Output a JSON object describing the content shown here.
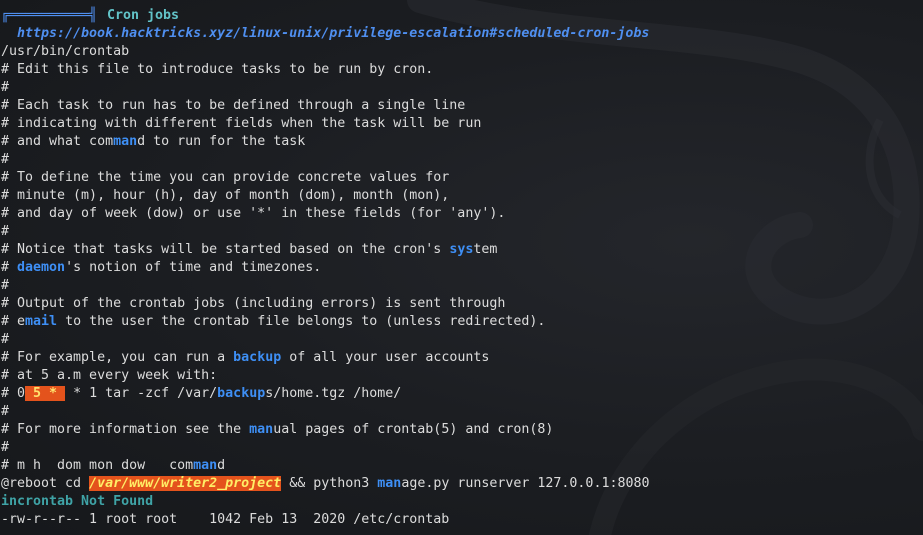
{
  "header": {
    "title": "Cron jobs",
    "url": "https://book.hacktricks.xyz/linux-unix/privilege-escalation#scheduled-cron-jobs"
  },
  "lines": {
    "l02": "/usr/bin/crontab",
    "l03": "# Edit this file to introduce tasks to be run by cron.",
    "l04": "#",
    "l05": "# Each task to run has to be defined through a single line",
    "l06": "# indicating with different fields when the task will be run",
    "l07a": "# and what com",
    "l07b": "man",
    "l07c": "d to run for the task",
    "l08": "#",
    "l09": "# To define the time you can provide concrete values for",
    "l10": "# minute (m), hour (h), day of month (dom), month (mon),",
    "l11": "# and day of week (dow) or use '*' in these fields (for 'any').",
    "l12": "#",
    "l13a": "# Notice that tasks will be started based on the cron's ",
    "l13b": "sys",
    "l13c": "tem",
    "l14a": "# ",
    "l14b": "daemon",
    "l14c": "'s notion of time and timezones.",
    "l15": "#",
    "l16": "# Output of the crontab jobs (including errors) is sent through",
    "l17a": "# e",
    "l17b": "mail",
    "l17c": " to the user the crontab file belongs to (unless redirected).",
    "l18": "#",
    "l19a": "# For example, you can run a ",
    "l19b": "backup",
    "l19c": " of all your user accounts",
    "l20": "# at 5 a.m every week with:",
    "l21a": "# 0",
    "l21b": " 5 * ",
    "l21c": " * 1 tar -zcf /var/",
    "l21d": "backup",
    "l21e": "s/home.tgz /home/",
    "l22": "#",
    "l23a": "# For more information see the ",
    "l23b": "man",
    "l23c": "ual pages of crontab(5) and cron(8)",
    "l24": "#",
    "l25a": "# m h  dom mon dow   com",
    "l25b": "man",
    "l25c": "d",
    "l26a": "@reboot cd ",
    "l26b": "/var/www/writer2_project",
    "l26c": " && python3 ",
    "l26d": "man",
    "l26e": "age.py runserver 127.0.0.1:8080",
    "l27": "incrontab Not Found",
    "l28": "-rw-r--r-- 1 root root    1042 Feb 13  2020 /etc/crontab"
  },
  "colors": {
    "background": "#191b1f",
    "text": "#dcdcdc",
    "keyword_blue": "#3e8ff5",
    "header_teal": "#62c3c8",
    "highlight_red": "#e4531c",
    "highlight_text_yellow": "#ffe36e",
    "notfound_teal": "#3fa3a6"
  }
}
